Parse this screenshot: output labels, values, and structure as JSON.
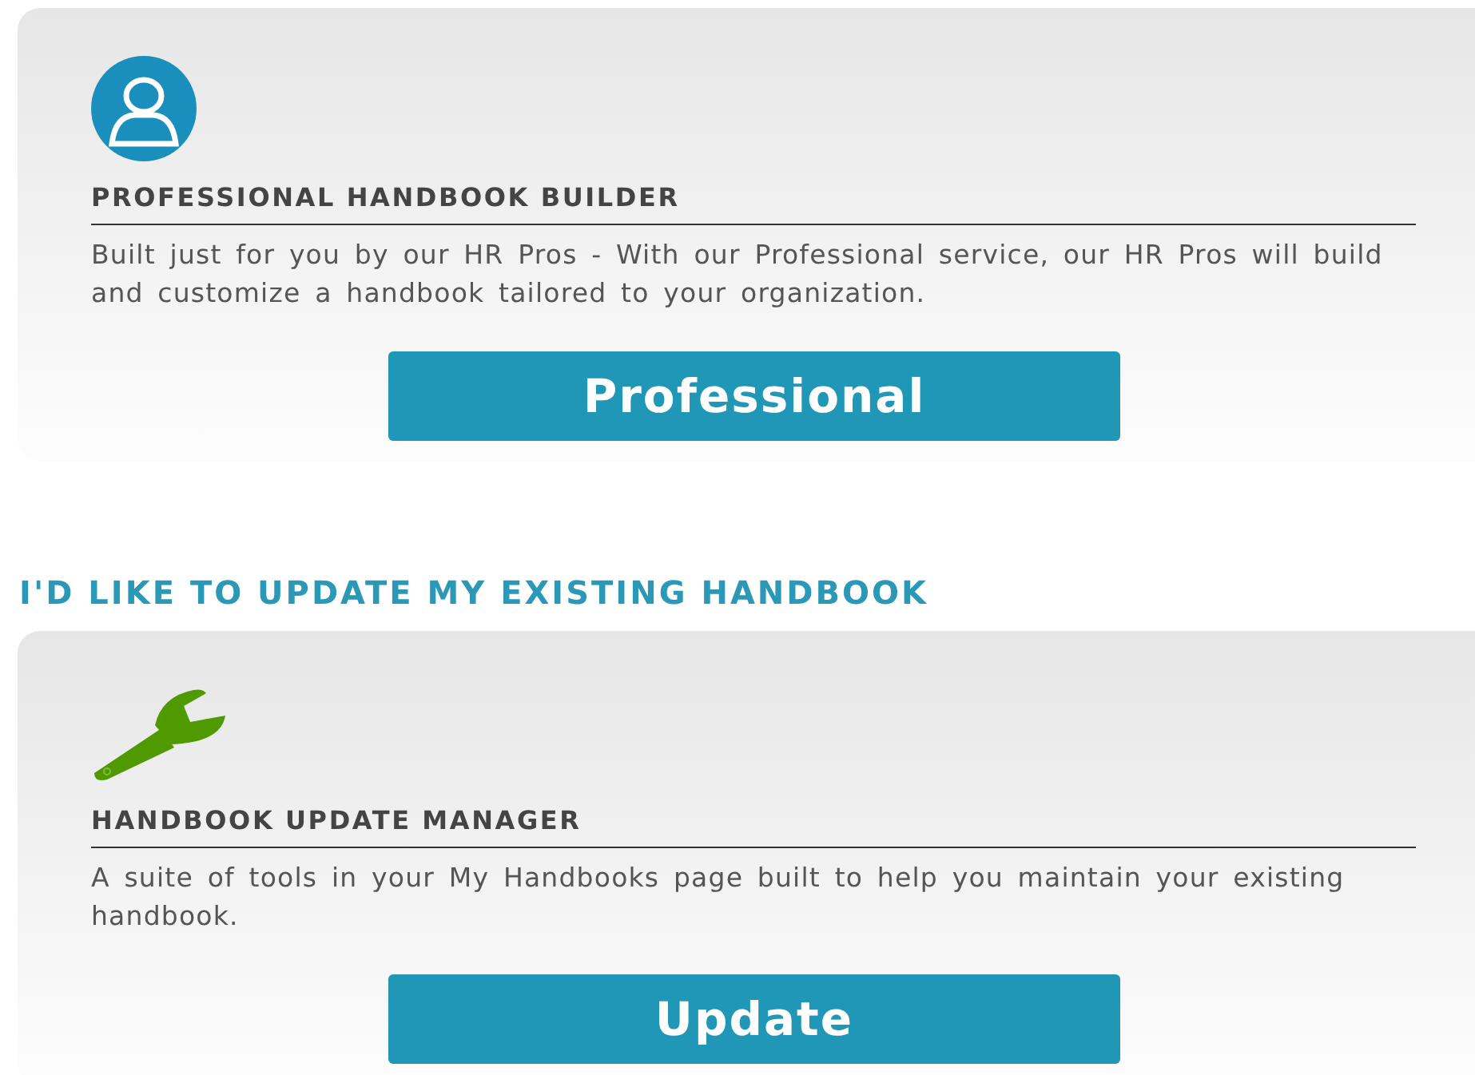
{
  "sections": [
    {
      "card": {
        "kind": "person",
        "title": "PROFESSIONAL HANDBOOK BUILDER",
        "description": "Built just for you by our HR Pros - With our Professional service, our HR Pros will build and customize a handbook tailored to your organization.",
        "button": "Professional"
      }
    },
    {
      "heading": "I'D LIKE TO UPDATE MY EXISTING HANDBOOK",
      "card": {
        "kind": "wrench",
        "title": "HANDBOOK UPDATE MANAGER",
        "description": "A suite of tools in your My Handbooks page built to help you maintain your existing handbook.",
        "button": "Update"
      }
    }
  ]
}
